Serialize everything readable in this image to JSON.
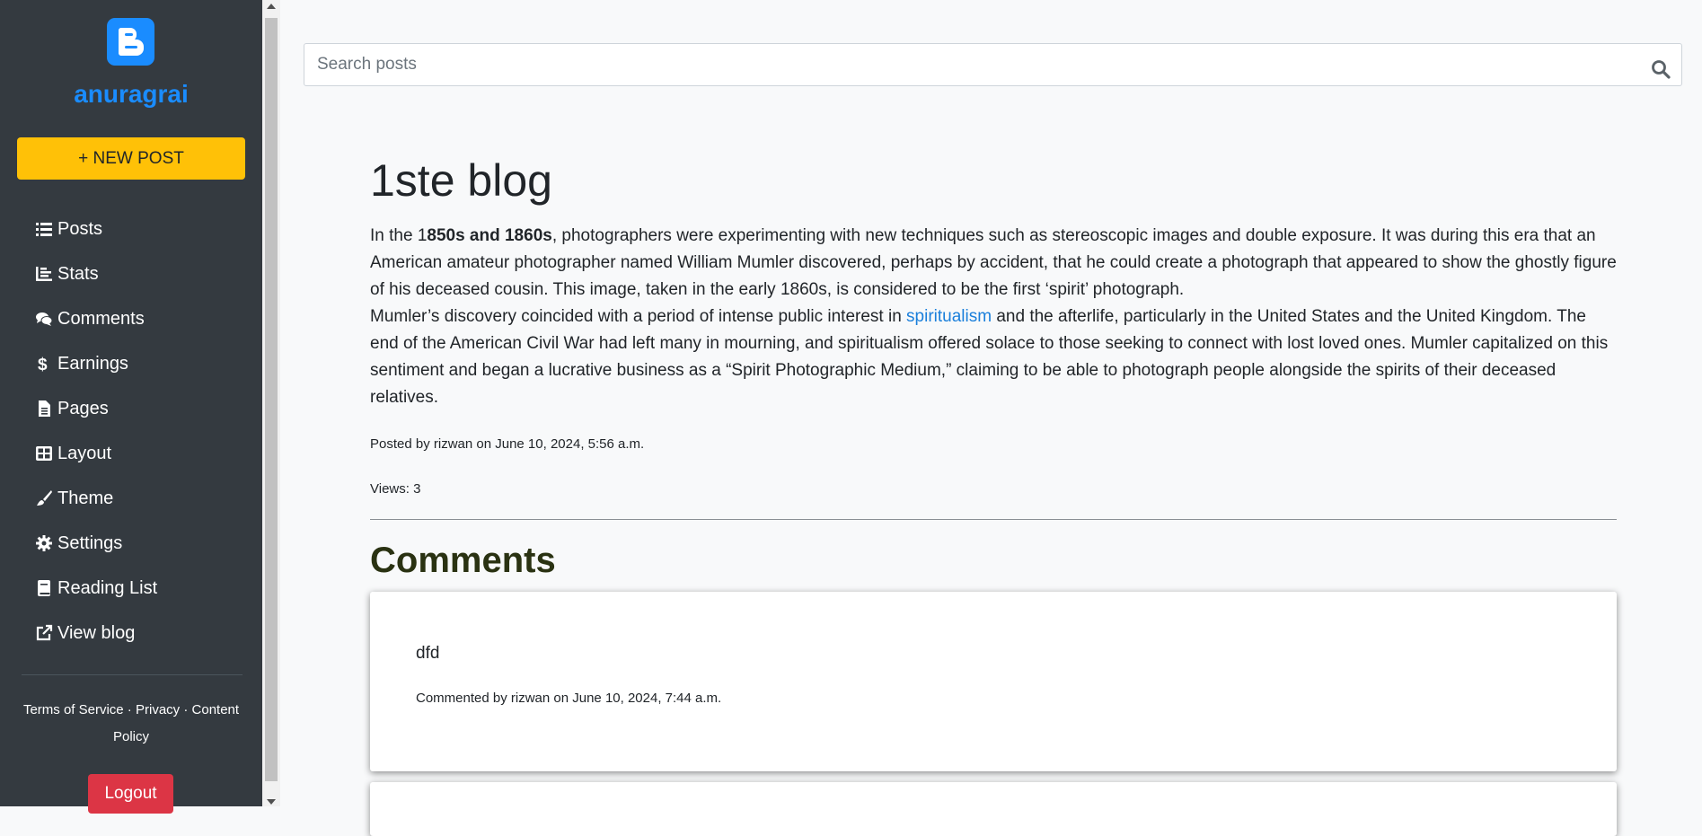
{
  "sidebar": {
    "brand": "anuragrai",
    "new_post_label": "+ NEW POST",
    "items": [
      {
        "label": "Posts",
        "icon": "list-icon"
      },
      {
        "label": "Stats",
        "icon": "chart-icon"
      },
      {
        "label": "Comments",
        "icon": "comments-icon"
      },
      {
        "label": "Earnings",
        "icon": "dollar-icon"
      },
      {
        "label": "Pages",
        "icon": "file-icon"
      },
      {
        "label": "Layout",
        "icon": "layout-icon"
      },
      {
        "label": "Theme",
        "icon": "brush-icon"
      },
      {
        "label": "Settings",
        "icon": "gear-icon"
      },
      {
        "label": "Reading List",
        "icon": "book-icon"
      },
      {
        "label": "View blog",
        "icon": "external-link-icon"
      }
    ],
    "footer": {
      "terms": "Terms of Service",
      "sep1": " · ",
      "privacy": "Privacy",
      "sep2": " · ",
      "content_policy": "Content Policy"
    },
    "logout_label": "Logout"
  },
  "search": {
    "placeholder": "Search posts",
    "value": ""
  },
  "post": {
    "title": "1ste blog",
    "p1_prefix": "In the 1",
    "p1_bold": "850s and 1860s",
    "p1_rest": ", photographers were experimenting with new techniques such as stereoscopic images and double exposure. It was during this era that an American amateur photographer named William Mumler discovered, perhaps by accident, that he could create a photograph that appeared to show the ghostly figure of his deceased cousin. This image, taken in the early 1860s, is considered to be the first ‘spirit’ photograph.",
    "p2_prefix": "Mumler’s discovery coincided with a period of intense public interest in ",
    "p2_link": "spiritualism",
    "p2_rest": " and the afterlife, particularly in the United States and the United Kingdom. The end of the American Civil War had left many in mourning, and spiritualism offered solace to those seeking to connect with lost loved ones. Mumler capitalized on this sentiment and began a lucrative business as a “Spirit Photographic Medium,” claiming to be able to photograph people alongside the spirits of their deceased relatives.",
    "posted_by": "Posted by rizwan on June 10, 2024, 5:56 a.m.",
    "views": "Views: 3"
  },
  "comments": {
    "heading": "Comments",
    "items": [
      {
        "text": "dfd",
        "meta": "Commented by rizwan on June 10, 2024, 7:44 a.m."
      },
      {
        "text": "",
        "meta": ""
      }
    ]
  },
  "colors": {
    "sidebar_bg": "#343a40",
    "brand_blue": "#1a8cff",
    "new_post_yellow": "#ffc107",
    "logout_red": "#dc3545",
    "link_blue": "#1a7fdb"
  }
}
